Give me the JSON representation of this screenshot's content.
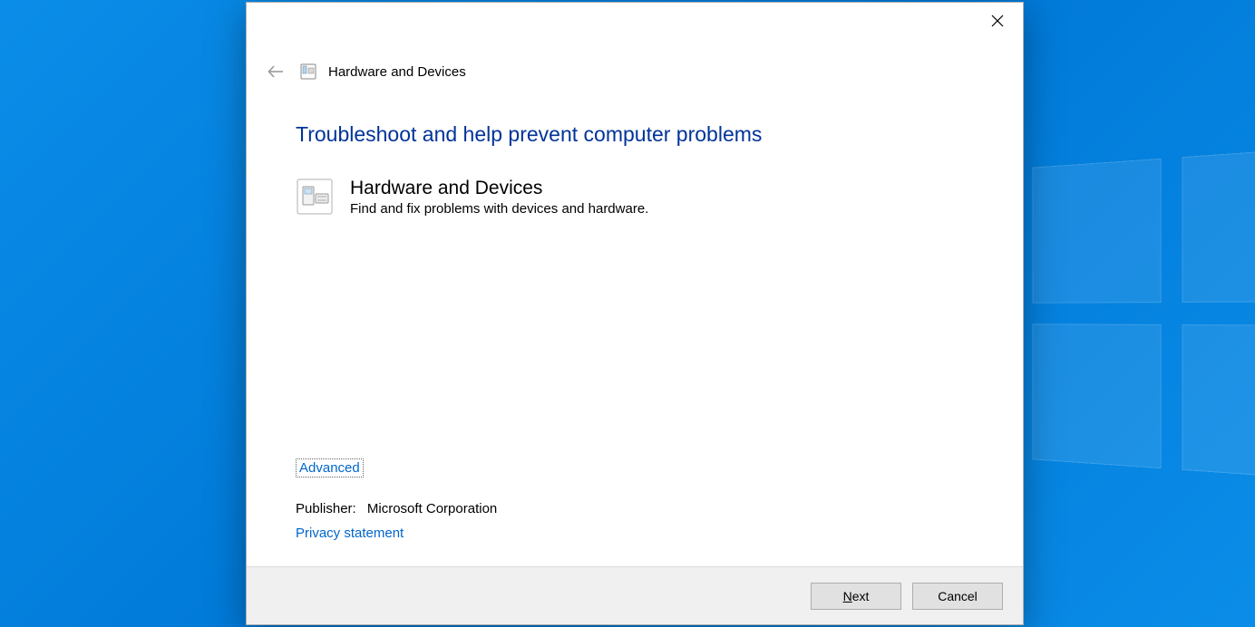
{
  "window": {
    "header_title": "Hardware and Devices"
  },
  "content": {
    "heading": "Troubleshoot and help prevent computer problems",
    "item": {
      "title": "Hardware and Devices",
      "description": "Find and fix problems with devices and hardware."
    },
    "advanced_link": "Advanced",
    "publisher_label": "Publisher:",
    "publisher_value": "Microsoft Corporation",
    "privacy_link": "Privacy statement"
  },
  "buttons": {
    "next": "Next",
    "cancel": "Cancel"
  }
}
